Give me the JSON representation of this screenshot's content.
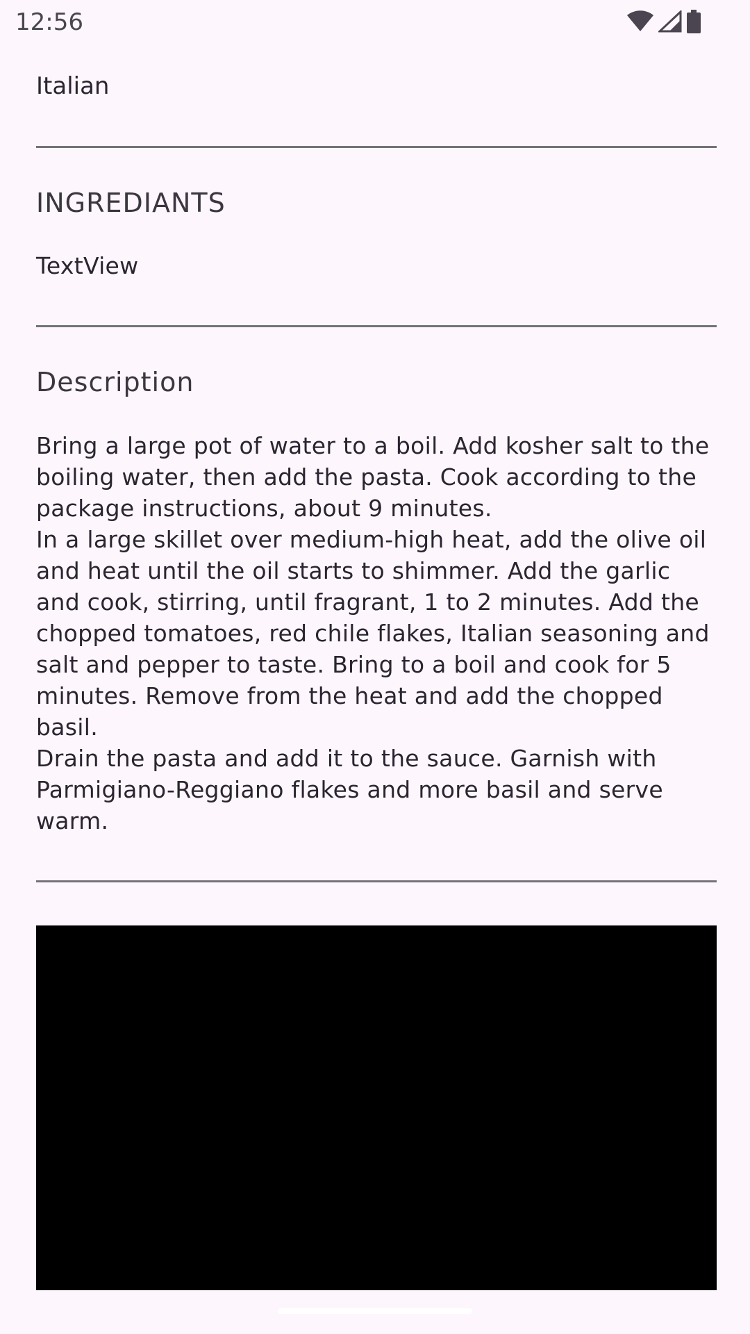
{
  "status_bar": {
    "time": "12:56",
    "icons": [
      "wifi-icon",
      "signal-icon",
      "battery-icon"
    ]
  },
  "recipe": {
    "cuisine": "Italian",
    "ingredients_heading": "INGREDIANTS",
    "ingredients_text": "TextView",
    "description_heading": "Description",
    "description_text": "Bring a large pot of water to a boil. Add kosher salt to the boiling water, then add the pasta. Cook according to the package instructions, about 9 minutes.\nIn a large skillet over medium-high heat, add the olive oil and heat until the oil starts to shimmer. Add the garlic and cook, stirring, until fragrant, 1 to 2 minutes. Add the chopped tomatoes, red chile flakes, Italian seasoning and salt and pepper to taste. Bring to a boil and cook for 5 minutes. Remove from the heat and add the chopped basil.\nDrain the pasta and add it to the sauce. Garnish with Parmigiano-Reggiano flakes and more basil and serve warm."
  },
  "colors": {
    "background": "#fdf7fd",
    "divider": "#75717a",
    "video": "#000000"
  }
}
